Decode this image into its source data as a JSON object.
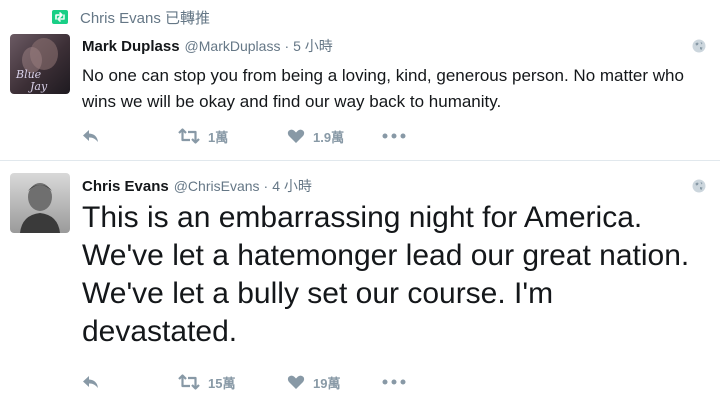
{
  "retweet_context": {
    "text": "Chris Evans 已轉推",
    "icon": "retweet-icon"
  },
  "tweets": [
    {
      "fullname": "Mark Duplass",
      "username": "@MarkDuplass",
      "separator": "·",
      "time": "5 小時",
      "avatar_caption": "Blue Jay",
      "text": "No one can stop you from being a loving, kind, generous person.  No matter who wins we will be okay and find our way back to humanity.",
      "retweets": "1萬",
      "likes": "1.9萬"
    },
    {
      "fullname": "Chris Evans",
      "username": "@ChrisEvans",
      "separator": "·",
      "time": "4 小時",
      "text": "This is an embarrassing night for America. We've let a hatemonger lead our great nation. We've let a bully set our course. I'm devastated.",
      "retweets": "15萬",
      "likes": "19萬"
    }
  ],
  "colors": {
    "text": "#14171a",
    "secondary": "#657786",
    "action": "#8899a6",
    "retweet_green": "#19cf86",
    "divider": "#e1e8ed"
  }
}
